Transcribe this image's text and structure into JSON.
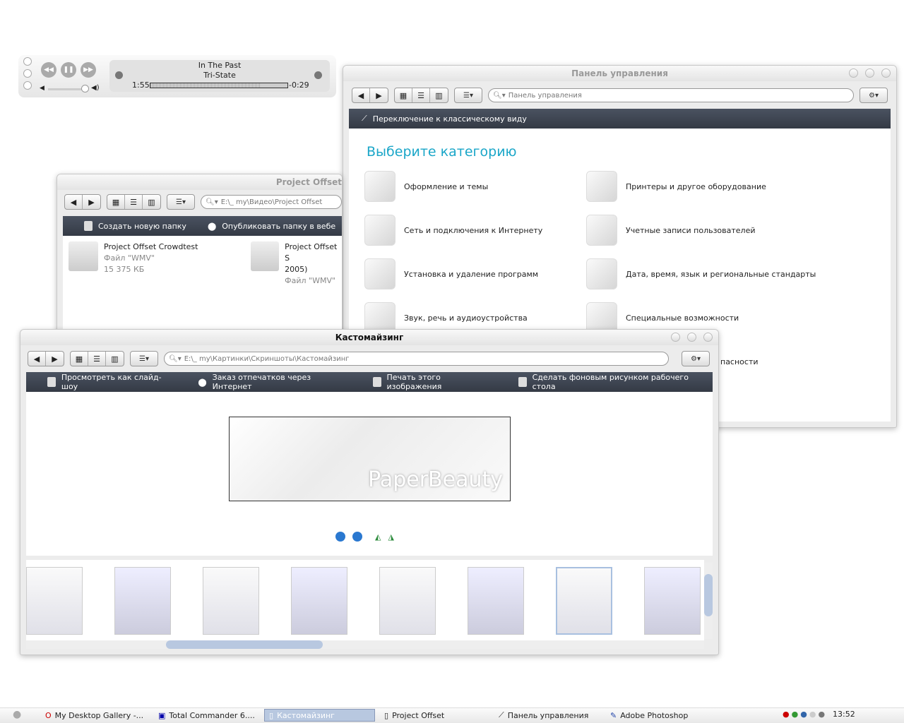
{
  "player": {
    "track": "In The Past",
    "artist": "Tri-State",
    "elapsed": "1:55",
    "remaining": "-0:29",
    "progress": 0.8,
    "volume": 0.95
  },
  "control_panel": {
    "title": "Панель управления",
    "search": "Панель управления",
    "task": "Переключение к классическому виду",
    "heading": "Выберите категорию",
    "heading_color": "#1aa6c8",
    "categories": [
      {
        "label": "Оформление и темы",
        "icon": "themes-icon"
      },
      {
        "label": "Принтеры и другое оборудование",
        "icon": "printer-icon"
      },
      {
        "label": "Сеть и подключения к Интернету",
        "icon": "network-plug-icon"
      },
      {
        "label": "Учетные записи пользователей",
        "icon": "user-accounts-icon"
      },
      {
        "label": "Установка и удаление программ",
        "icon": "add-remove-icon"
      },
      {
        "label": "Дата, время, язык и региональные стандарты",
        "icon": "date-time-icon"
      },
      {
        "label": "Звук, речь и аудиоустройства",
        "icon": "sound-icon"
      },
      {
        "label": "Специальные возможности",
        "icon": "accessibility-icon"
      },
      {
        "label": "пасности",
        "icon": "security-icon"
      }
    ]
  },
  "project_offset": {
    "title": "Project Offset",
    "search": "E:\\_ my\\Видео\\Project Offset",
    "tasks": [
      "Создать новую папку",
      "Опубликовать папку в вебе"
    ],
    "files": [
      {
        "name": "Project Offset Crowdtest",
        "type": "Файл \"WMV\"",
        "size": "15 375 КБ"
      },
      {
        "name": "Project Offset S",
        "name2": "2005)",
        "type": "Файл \"WMV\""
      }
    ]
  },
  "customizing": {
    "title": "Кастомайзинг",
    "search": "E:\\_ my\\Картинки\\Скриншоты\\Кастомайзинг",
    "tasks": [
      "Просмотреть как слайд-шоу",
      "Заказ отпечатков через Интернет",
      "Печать этого изображения",
      "Сделать фоновым рисунком рабочего стола"
    ],
    "preview_text": "PaperBeauty",
    "thumb_count": 8,
    "selected_thumb": 6
  },
  "taskbar": {
    "items": [
      "My Desktop Gallery -...",
      "Total Commander 6....",
      "Кастомайзинг",
      "Project Offset",
      "Панель управления",
      "Adobe Photoshop"
    ],
    "active": 2,
    "clock": "13:52"
  }
}
